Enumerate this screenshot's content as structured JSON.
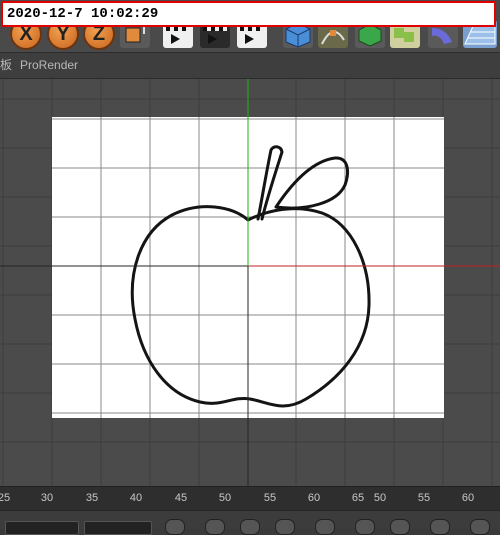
{
  "overlay": {
    "timestamp": "2020-12-7 10:02:29"
  },
  "toolbar": {
    "axis_x": "X",
    "axis_y": "Y",
    "axis_z": "Z"
  },
  "tabs": {
    "partial_label": "板",
    "prorender": "ProRender"
  },
  "timeline": {
    "ticks": [
      "25",
      "30",
      "35",
      "40",
      "45",
      "50",
      "55",
      "60",
      "65",
      "50",
      "55",
      "60"
    ]
  },
  "colors": {
    "axis_y": "#1db21d",
    "axis_x": "#c02020",
    "accent_orange": "#e08a3c"
  }
}
